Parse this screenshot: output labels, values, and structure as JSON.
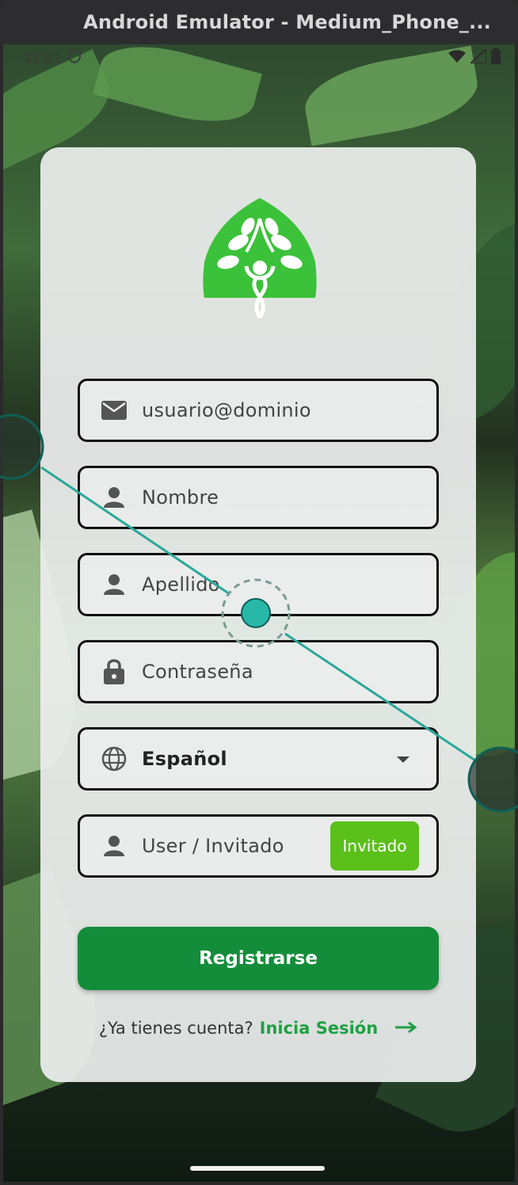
{
  "window": {
    "title": "Android Emulator - Medium_Phone_..."
  },
  "statusbar": {
    "time": "12:21"
  },
  "form": {
    "email_placeholder": "usuario@dominio",
    "first_name_placeholder": "Nombre",
    "last_name_placeholder": "Apellido",
    "password_placeholder": "Contraseña",
    "language_value": "Español",
    "user_type_value": "User / Invitado",
    "guest_button_label": "Invitado",
    "register_button_label": "Registrarse"
  },
  "footer": {
    "question": "¿Ya tienes cuenta?",
    "login_link": "Inicia Sesión"
  },
  "icons": {
    "email": "mail-icon",
    "person": "person-icon",
    "lock": "lock-icon",
    "language": "globe-icon",
    "dropdown": "caret-down-icon",
    "arrow": "arrow-right-icon"
  },
  "colors": {
    "primary_green": "#138d3a",
    "guest_green": "#5bc01a",
    "link_green": "#1ea143",
    "logo_green": "#3cc13b"
  }
}
